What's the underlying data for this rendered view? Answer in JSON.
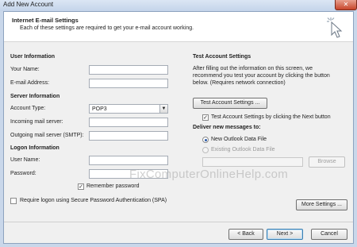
{
  "window": {
    "title": "Add New Account",
    "close_glyph": "✕"
  },
  "header": {
    "title": "Internet E-mail Settings",
    "subtitle": "Each of these settings are required to get your e-mail account working."
  },
  "user_info": {
    "heading": "User Information",
    "your_name_label": "Your Name:",
    "your_name_value": "",
    "email_label": "E-mail Address:",
    "email_value": ""
  },
  "server_info": {
    "heading": "Server Information",
    "account_type_label": "Account Type:",
    "account_type_value": "POP3",
    "incoming_label": "Incoming mail server:",
    "incoming_value": "",
    "outgoing_label": "Outgoing mail server (SMTP):",
    "outgoing_value": ""
  },
  "logon_info": {
    "heading": "Logon Information",
    "user_name_label": "User Name:",
    "user_name_value": "",
    "password_label": "Password:",
    "password_value": "",
    "remember_label": "Remember password",
    "remember_checked": true,
    "spa_label": "Require logon using Secure Password Authentication (SPA)",
    "spa_checked": false
  },
  "test_settings": {
    "heading": "Test Account Settings",
    "description_line1": "After filling out the information on this screen, we",
    "description_line2": "recommend you test your account by clicking the button",
    "description_line3": "below. (Requires network connection)",
    "test_button_label": "Test Account Settings ...",
    "test_next_label": "Test Account Settings by clicking the Next button",
    "test_next_checked": true
  },
  "delivery": {
    "heading": "Deliver new messages to:",
    "option_new": "New Outlook Data File",
    "option_existing": "Existing Outlook Data File",
    "selected": "New Outlook Data File",
    "existing_path_value": "",
    "browse_label": "Browse"
  },
  "buttons": {
    "more_settings": "More Settings ...",
    "back": "< Back",
    "next": "Next >",
    "cancel": "Cancel"
  },
  "icons": {
    "checkbox_mark": "✓",
    "dropdown_arrow": "▼",
    "header_icon": "cursor-click-icon"
  },
  "watermark": "FixComputerOnlineHelp.com"
}
